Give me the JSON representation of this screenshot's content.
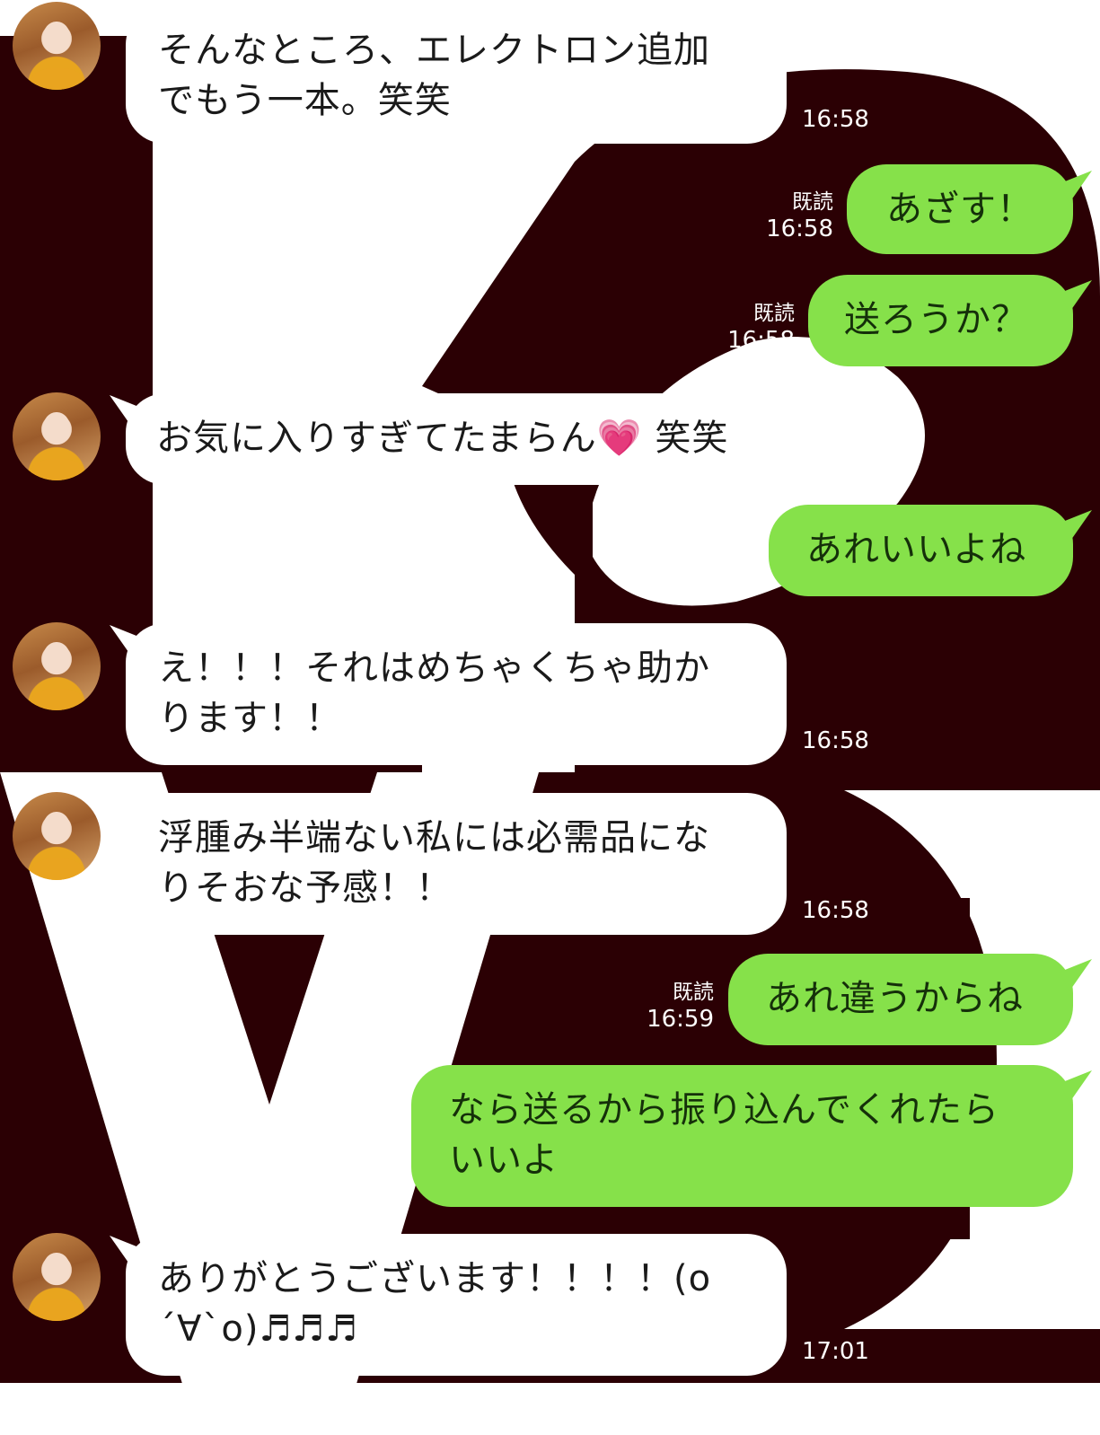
{
  "messages": [
    {
      "id": "m1",
      "side": "in",
      "text": "そんなところ、エレクトロン追加\nでもう一本。笑笑",
      "time": "16:58"
    },
    {
      "id": "m2",
      "side": "out",
      "text": "あざす！",
      "read": "既読",
      "time": "16:58"
    },
    {
      "id": "m3",
      "side": "out",
      "text": "送ろうか？",
      "read": "既読",
      "time": "16:58"
    },
    {
      "id": "m4",
      "side": "in",
      "text": "お気に入りすぎてたまらん💗 笑笑",
      "time": "16:58"
    },
    {
      "id": "m5",
      "side": "out",
      "text": "あれいいよね"
    },
    {
      "id": "m6",
      "side": "in",
      "text": "え！！！それはめちゃくちゃ助か\nります！！",
      "time": "16:58"
    },
    {
      "id": "m7",
      "side": "in",
      "text": "浮腫み半端ない私には必需品にな\nりそおな予感！！",
      "time": "16:58"
    },
    {
      "id": "m8",
      "side": "out",
      "text": "あれ違うからね",
      "read": "既読",
      "time": "16:59"
    },
    {
      "id": "m9",
      "side": "out",
      "text": "なら送るから振り込んでくれたら\nいいよ"
    },
    {
      "id": "m10",
      "side": "in",
      "text": "ありがとうございます！！！！(o\n´∀`o)♬♬♬",
      "time": "17:01"
    }
  ],
  "colors": {
    "outgoing_bubble": "#86e14a",
    "incoming_bubble": "#ffffff",
    "background_art": "#2b0004"
  }
}
